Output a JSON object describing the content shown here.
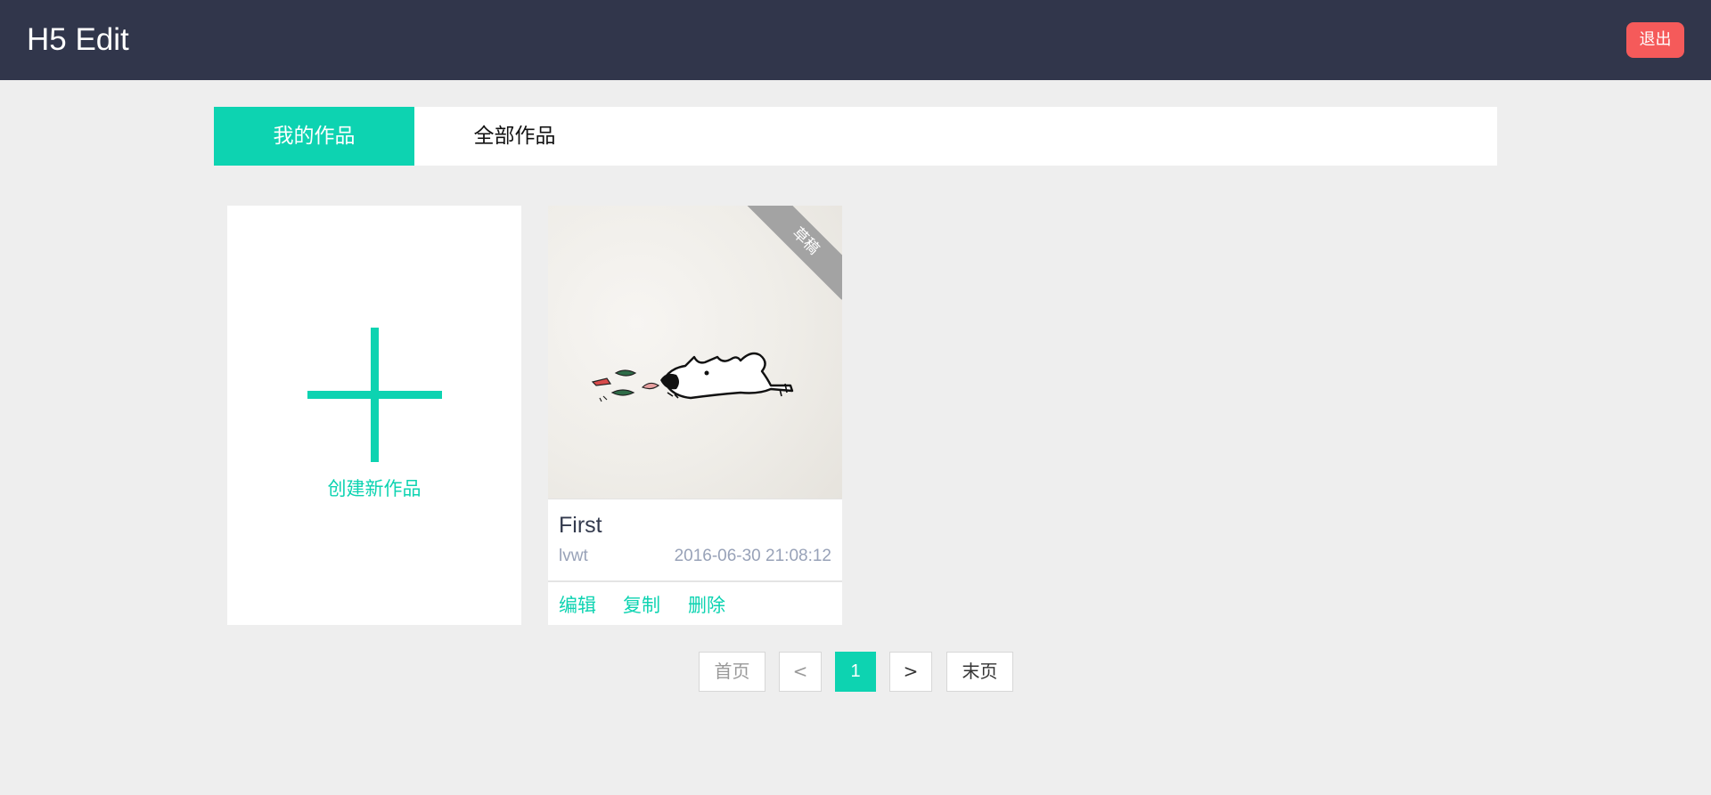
{
  "header": {
    "title": "H5 Edit",
    "logout_label": "退出"
  },
  "tabs": [
    {
      "label": "我的作品",
      "active": true
    },
    {
      "label": "全部作品",
      "active": false
    }
  ],
  "create_card": {
    "label": "创建新作品"
  },
  "works": [
    {
      "title": "First",
      "author": "lvwt",
      "date": "2016-06-30 21:08:12",
      "status_badge": "草稿",
      "actions": {
        "edit": "编辑",
        "copy": "复制",
        "delete": "删除"
      }
    }
  ],
  "pagination": {
    "first": "首页",
    "prev": "<",
    "current": "1",
    "next": ">",
    "last": "末页"
  },
  "colors": {
    "topbar": "#31364b",
    "accent": "#0dd3b1",
    "danger": "#f55a5a",
    "background": "#eeeeee",
    "badge": "#a3a3a3"
  }
}
